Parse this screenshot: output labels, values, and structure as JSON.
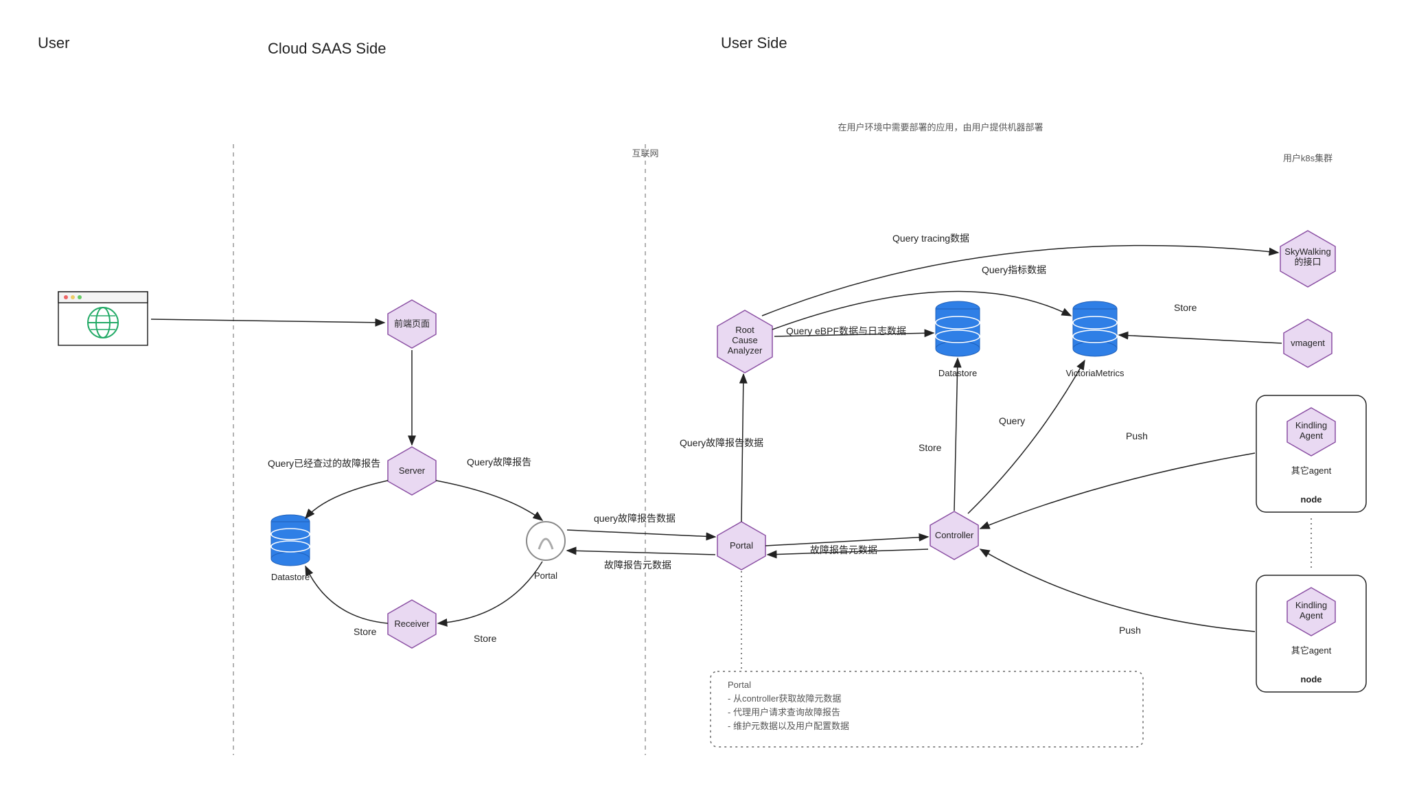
{
  "sections": {
    "user": "User",
    "saas": "Cloud SAAS Side",
    "user_side": "User Side"
  },
  "dividers": {
    "internet": "互联网"
  },
  "annotations": {
    "user_env": "在用户环境中需要部署的应用，由用户提供机器部署",
    "k8s_cluster": "用户k8s集群"
  },
  "nodes": {
    "browser": "Browser",
    "frontend": "前端页面",
    "server": "Server",
    "receiver": "Receiver",
    "saas_portal": "Portal",
    "saas_datastore": "Datastore",
    "user_portal": "Portal",
    "rca": "Root Cause Analyzer",
    "controller": "Controller",
    "user_datastore": "Datastore",
    "victoria": "VictoriaMetrics",
    "skywalking1": "SkyWalking 的接口",
    "vmagent": "vmagent",
    "kindling1": "Kindling Agent",
    "kindling1_sub": "其它agent",
    "node1": "node",
    "kindling2": "Kindling Agent",
    "kindling2_sub": "其它agent",
    "node2": "node"
  },
  "edges": {
    "saas_query_checked": "Query已经查过的故障报告",
    "saas_query_report": "Query故障报告",
    "saas_store1": "Store",
    "saas_store2": "Store",
    "cross_query_report_data": "query故障报告数据",
    "cross_report_meta": "故障报告元数据",
    "user_query_report_data": "Query故障报告数据",
    "user_report_meta": "故障报告元数据",
    "user_query_tracing": "Query tracing数据",
    "user_query_metrics": "Query指标数据",
    "user_query_ebpf": "Query eBPF数据与日志数据",
    "user_store_ds": "Store",
    "user_query_vm": "Query",
    "user_vmagent_store": "Store",
    "user_push1": "Push",
    "user_push2": "Push"
  },
  "note_box": {
    "title": "Portal",
    "line1": "- 从controller获取故障元数据",
    "line2": "- 代理用户请求查询故障报告",
    "line3": "- 维护元数据以及用户配置数据"
  }
}
